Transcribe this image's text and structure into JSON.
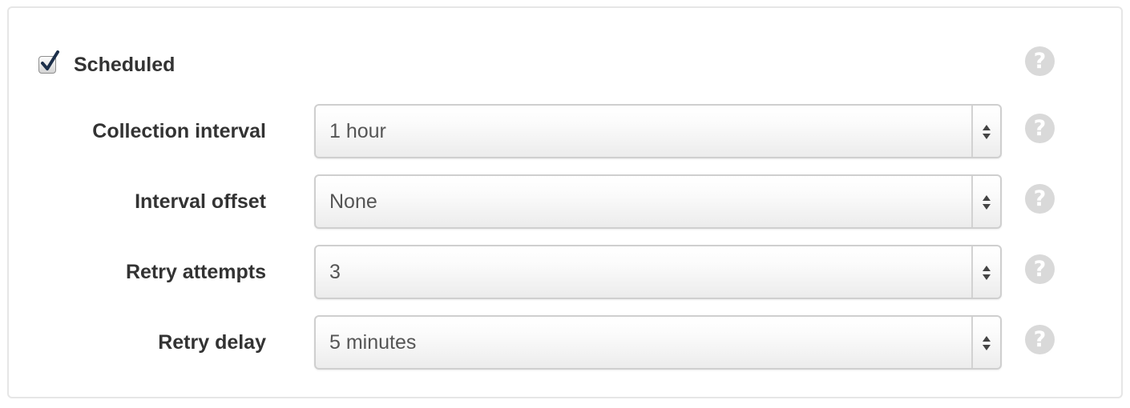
{
  "scheduled": {
    "label": "Scheduled",
    "checked": true
  },
  "fields": [
    {
      "label": "Collection interval",
      "value": "1 hour"
    },
    {
      "label": "Interval offset",
      "value": "None"
    },
    {
      "label": "Retry attempts",
      "value": "3"
    },
    {
      "label": "Retry delay",
      "value": "5 minutes"
    }
  ],
  "help": {
    "glyph": "?"
  },
  "icons": {
    "checkbox": "checkmark-icon",
    "help": "question-circle-icon",
    "select_arrows": "updown-arrows-icon"
  },
  "colors": {
    "label_text": "#333333",
    "value_text": "#555555",
    "help_icon": "#d9d9d9",
    "border": "#cfcfcf"
  }
}
